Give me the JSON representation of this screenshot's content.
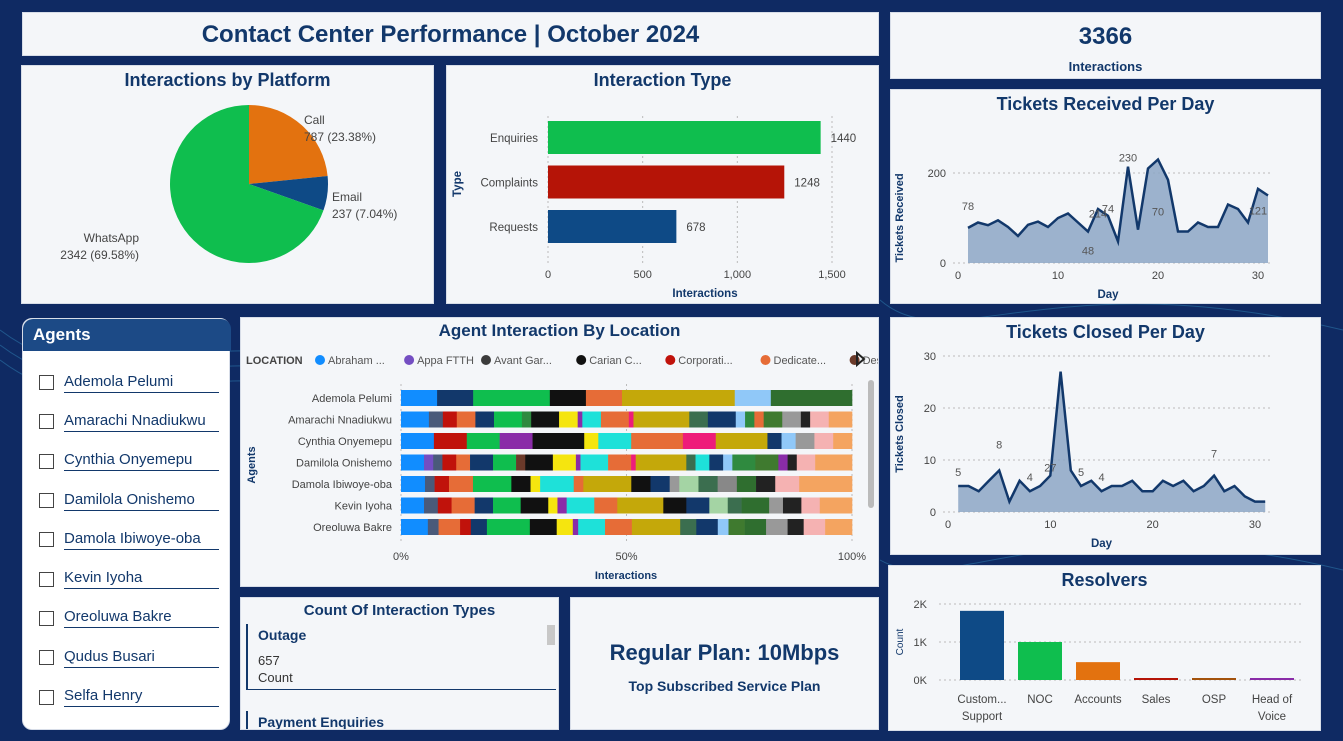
{
  "header": {
    "title": "Contact Center Performance | October 2024"
  },
  "kpi": {
    "value": "3366",
    "label": "Interactions"
  },
  "platform_chart": {
    "title": "Interactions by Platform",
    "slices": [
      {
        "name": "Call",
        "value": 787,
        "label": "787 (23.38%)",
        "color": "#e3720f"
      },
      {
        "name": "Email",
        "value": 237,
        "label": "237 (7.04%)",
        "color": "#0e4a86"
      },
      {
        "name": "WhatsApp",
        "value": 2342,
        "label": "2342 (69.58%)",
        "color": "#0fbe4e"
      }
    ]
  },
  "type_chart": {
    "title": "Interaction Type",
    "ylabel": "Type",
    "xlabel": "Interactions",
    "ticks": [
      "0",
      "500",
      "1,000",
      "1,500"
    ],
    "bars": [
      {
        "name": "Enquiries",
        "value": 1440,
        "label": "1440",
        "color": "#0fbe4e"
      },
      {
        "name": "Complaints",
        "value": 1248,
        "label": "1248",
        "color": "#b51407"
      },
      {
        "name": "Requests",
        "value": 678,
        "label": "678",
        "color": "#0e4a86"
      }
    ]
  },
  "received_chart": {
    "title": "Tickets Received Per Day",
    "ylabel": "Tickets Received",
    "xlabel": "Day",
    "yticks": [
      "0",
      "200"
    ],
    "xticks": [
      "0",
      "10",
      "20",
      "30"
    ],
    "labels": [
      "78",
      "214",
      "48",
      "74",
      "230",
      "70",
      "121"
    ]
  },
  "closed_chart": {
    "title": "Tickets Closed Per Day",
    "ylabel": "Tickets Closed",
    "xlabel": "Day",
    "yticks": [
      "0",
      "10",
      "20",
      "30"
    ],
    "xticks": [
      "0",
      "10",
      "20",
      "30"
    ],
    "labels": [
      "5",
      "8",
      "4",
      "27",
      "5",
      "4",
      "7"
    ]
  },
  "agents": {
    "title": "Agents",
    "items": [
      "Ademola Pelumi",
      "Amarachi Nnadiukwu",
      "Cynthia Onyemepu",
      "Damilola Onishemo",
      "Damola Ibiwoye-oba",
      "Kevin Iyoha",
      "Oreoluwa Bakre",
      "Qudus Busari",
      "Selfa Henry"
    ]
  },
  "location_chart": {
    "title": "Agent Interaction By Location",
    "legend_title": "LOCATION",
    "legend": [
      {
        "name": "Abraham ...",
        "color": "#118dff"
      },
      {
        "name": "Appa FTTH",
        "color": "#744ec2"
      },
      {
        "name": "Avant Gar...",
        "color": "#3b3b3b"
      },
      {
        "name": "Carian C...",
        "color": "#111111"
      },
      {
        "name": "Corporati...",
        "color": "#c0120b"
      },
      {
        "name": "Dedicate...",
        "color": "#e66c37"
      },
      {
        "name": "Destiny",
        "color": "#6b3a2a"
      }
    ],
    "ylabel": "Agents",
    "xlabel": "Interactions",
    "xticks": [
      "0%",
      "50%",
      "100%"
    ],
    "rows": [
      "Ademola Pelumi",
      "Amarachi Nnadiukwu",
      "Cynthia Onyemepu",
      "Damilola Onishemo",
      "Damola Ibiwoye-oba",
      "Kevin Iyoha",
      "Oreoluwa Bakre"
    ]
  },
  "count_types": {
    "title": "Count Of Interaction Types",
    "card1": {
      "name": "Outage",
      "value": "657",
      "label": "Count"
    },
    "card2": {
      "name": "Payment Enquiries"
    }
  },
  "plan": {
    "title": "Regular Plan: 10Mbps",
    "subtitle": "Top Subscribed Service Plan"
  },
  "resolvers_chart": {
    "title": "Resolvers",
    "ylabel": "Count",
    "yticks": [
      "0K",
      "1K",
      "2K"
    ],
    "bars": [
      {
        "name": "Custom...\nSupport",
        "value": 1820,
        "color": "#0e4a86"
      },
      {
        "name": "NOC",
        "value": 1000,
        "color": "#0fbe4e"
      },
      {
        "name": "Accounts",
        "value": 470,
        "color": "#e3720f"
      },
      {
        "name": "Sales",
        "value": 40,
        "color": "#b51407"
      },
      {
        "name": "OSP",
        "value": 20,
        "color": "#a3520c"
      },
      {
        "name": "Head of\nVoice",
        "value": 15,
        "color": "#8a2ca8"
      }
    ]
  },
  "chart_data": [
    {
      "type": "pie",
      "title": "Interactions by Platform",
      "categories": [
        "Call",
        "Email",
        "WhatsApp"
      ],
      "values": [
        787,
        237,
        2342
      ]
    },
    {
      "type": "bar",
      "title": "Interaction Type",
      "categories": [
        "Enquiries",
        "Complaints",
        "Requests"
      ],
      "values": [
        1440,
        1248,
        678
      ],
      "xlabel": "Interactions",
      "ylabel": "Type",
      "xlim": [
        0,
        1600
      ]
    },
    {
      "type": "area",
      "title": "Tickets Received Per Day",
      "xlabel": "Day",
      "ylabel": "Tickets Received",
      "x": [
        1,
        2,
        3,
        4,
        5,
        6,
        7,
        8,
        9,
        10,
        11,
        12,
        13,
        14,
        15,
        16,
        17,
        18,
        19,
        20,
        21,
        22,
        23,
        24,
        25,
        26,
        27,
        28,
        29,
        30,
        31
      ],
      "values": [
        78,
        90,
        84,
        95,
        80,
        60,
        85,
        92,
        80,
        100,
        110,
        90,
        70,
        120,
        105,
        48,
        214,
        74,
        210,
        230,
        185,
        70,
        70,
        90,
        80,
        80,
        130,
        120,
        90,
        165,
        150,
        121
      ],
      "xlim": [
        0,
        32
      ],
      "ylim": [
        0,
        250
      ]
    },
    {
      "type": "area",
      "title": "Tickets Closed Per Day",
      "xlabel": "Day",
      "ylabel": "Tickets Closed",
      "x": [
        1,
        2,
        3,
        4,
        5,
        6,
        7,
        8,
        9,
        10,
        11,
        12,
        13,
        14,
        15,
        16,
        17,
        18,
        19,
        20,
        21,
        22,
        23,
        24,
        25,
        26,
        27,
        28,
        29,
        30,
        31
      ],
      "values": [
        5,
        5,
        4,
        6,
        8,
        2,
        6,
        4,
        5,
        7,
        27,
        8,
        5,
        6,
        4,
        5,
        5,
        6,
        4,
        4,
        6,
        5,
        6,
        4,
        5,
        7,
        4,
        5,
        3,
        2,
        2
      ],
      "xlim": [
        0,
        32
      ],
      "ylim": [
        0,
        32
      ]
    },
    {
      "type": "bar",
      "title": "Agent Interaction By Location",
      "xlabel": "Interactions",
      "ylabel": "Agents",
      "categories": [
        "Ademola Pelumi",
        "Amarachi Nnadiukwu",
        "Cynthia Onyemepu",
        "Damilola Onishemo",
        "Damola Ibiwoye-oba",
        "Kevin Iyoha",
        "Oreoluwa Bakre"
      ],
      "stacked_percent": true,
      "segments": [
        [
          {
            "c": "#118dff",
            "w": 8
          },
          {
            "c": "#12386b",
            "w": 8
          },
          {
            "c": "#0fbe4e",
            "w": 17
          },
          {
            "c": "#111111",
            "w": 8
          },
          {
            "c": "#e66c37",
            "w": 8
          },
          {
            "c": "#c4a80a",
            "w": 25
          },
          {
            "c": "#90c8f8",
            "w": 8
          },
          {
            "c": "#2f6e2f",
            "w": 18
          }
        ],
        [
          {
            "c": "#118dff",
            "w": 6
          },
          {
            "c": "#4a5a7a",
            "w": 3
          },
          {
            "c": "#c0120b",
            "w": 3
          },
          {
            "c": "#e66c37",
            "w": 4
          },
          {
            "c": "#12386b",
            "w": 4
          },
          {
            "c": "#0fbe4e",
            "w": 6
          },
          {
            "c": "#2f8a3f",
            "w": 2
          },
          {
            "c": "#111111",
            "w": 6
          },
          {
            "c": "#f5e50f",
            "w": 4
          },
          {
            "c": "#8a2ca8",
            "w": 1
          },
          {
            "c": "#1ee1d9",
            "w": 4
          },
          {
            "c": "#e66c37",
            "w": 6
          },
          {
            "c": "#ee1c7a",
            "w": 1
          },
          {
            "c": "#c4a80a",
            "w": 12
          },
          {
            "c": "#3b6e4f",
            "w": 4
          },
          {
            "c": "#12386b",
            "w": 6
          },
          {
            "c": "#90c8f8",
            "w": 2
          },
          {
            "c": "#2f8a3f",
            "w": 2
          },
          {
            "c": "#e66c37",
            "w": 2
          },
          {
            "c": "#3f7a2f",
            "w": 4
          },
          {
            "c": "#999999",
            "w": 4
          },
          {
            "c": "#222222",
            "w": 2
          },
          {
            "c": "#f5b2b2",
            "w": 4
          },
          {
            "c": "#f4a460",
            "w": 5
          }
        ],
        [
          {
            "c": "#118dff",
            "w": 7
          },
          {
            "c": "#c0120b",
            "w": 7
          },
          {
            "c": "#0fbe4e",
            "w": 7
          },
          {
            "c": "#8a2ca8",
            "w": 7
          },
          {
            "c": "#111111",
            "w": 11
          },
          {
            "c": "#f5e50f",
            "w": 3
          },
          {
            "c": "#1ee1d9",
            "w": 7
          },
          {
            "c": "#e66c37",
            "w": 11
          },
          {
            "c": "#ee1c7a",
            "w": 7
          },
          {
            "c": "#c4a80a",
            "w": 11
          },
          {
            "c": "#12386b",
            "w": 3
          },
          {
            "c": "#90c8f8",
            "w": 3
          },
          {
            "c": "#999999",
            "w": 4
          },
          {
            "c": "#f5b2b2",
            "w": 4
          },
          {
            "c": "#f4a460",
            "w": 4
          }
        ],
        [
          {
            "c": "#118dff",
            "w": 5
          },
          {
            "c": "#744ec2",
            "w": 2
          },
          {
            "c": "#4a5a7a",
            "w": 2
          },
          {
            "c": "#c0120b",
            "w": 3
          },
          {
            "c": "#e66c37",
            "w": 3
          },
          {
            "c": "#12386b",
            "w": 5
          },
          {
            "c": "#0fbe4e",
            "w": 5
          },
          {
            "c": "#6b3a2a",
            "w": 2
          },
          {
            "c": "#111111",
            "w": 6
          },
          {
            "c": "#f5e50f",
            "w": 5
          },
          {
            "c": "#8a2ca8",
            "w": 1
          },
          {
            "c": "#1ee1d9",
            "w": 6
          },
          {
            "c": "#e66c37",
            "w": 5
          },
          {
            "c": "#ee1c7a",
            "w": 1
          },
          {
            "c": "#c4a80a",
            "w": 11
          },
          {
            "c": "#3b6e4f",
            "w": 2
          },
          {
            "c": "#1ee1d9",
            "w": 3
          },
          {
            "c": "#12386b",
            "w": 3
          },
          {
            "c": "#90c8f8",
            "w": 2
          },
          {
            "c": "#2f8a3f",
            "w": 5
          },
          {
            "c": "#3f7a2f",
            "w": 5
          },
          {
            "c": "#8a2ca8",
            "w": 2
          },
          {
            "c": "#222222",
            "w": 2
          },
          {
            "c": "#f5b2b2",
            "w": 4
          },
          {
            "c": "#f4a460",
            "w": 8
          }
        ],
        [
          {
            "c": "#118dff",
            "w": 5
          },
          {
            "c": "#4a5a7a",
            "w": 2
          },
          {
            "c": "#c0120b",
            "w": 3
          },
          {
            "c": "#e66c37",
            "w": 5
          },
          {
            "c": "#0fbe4e",
            "w": 8
          },
          {
            "c": "#111111",
            "w": 4
          },
          {
            "c": "#f5e50f",
            "w": 2
          },
          {
            "c": "#1ee1d9",
            "w": 7
          },
          {
            "c": "#e66c37",
            "w": 2
          },
          {
            "c": "#c4a80a",
            "w": 10
          },
          {
            "c": "#111111",
            "w": 4
          },
          {
            "c": "#12386b",
            "w": 4
          },
          {
            "c": "#999999",
            "w": 2
          },
          {
            "c": "#a4d4a4",
            "w": 4
          },
          {
            "c": "#3b6e4f",
            "w": 4
          },
          {
            "c": "#888888",
            "w": 4
          },
          {
            "c": "#2f6e2f",
            "w": 4
          },
          {
            "c": "#222222",
            "w": 4
          },
          {
            "c": "#f5b2b2",
            "w": 5
          },
          {
            "c": "#f4a460",
            "w": 11
          }
        ],
        [
          {
            "c": "#118dff",
            "w": 5
          },
          {
            "c": "#4a5a7a",
            "w": 3
          },
          {
            "c": "#c0120b",
            "w": 3
          },
          {
            "c": "#e66c37",
            "w": 5
          },
          {
            "c": "#12386b",
            "w": 4
          },
          {
            "c": "#0fbe4e",
            "w": 6
          },
          {
            "c": "#111111",
            "w": 6
          },
          {
            "c": "#f5e50f",
            "w": 2
          },
          {
            "c": "#8a2ca8",
            "w": 2
          },
          {
            "c": "#1ee1d9",
            "w": 6
          },
          {
            "c": "#e66c37",
            "w": 5
          },
          {
            "c": "#c4a80a",
            "w": 10
          },
          {
            "c": "#111111",
            "w": 5
          },
          {
            "c": "#12386b",
            "w": 5
          },
          {
            "c": "#a4d4a4",
            "w": 4
          },
          {
            "c": "#3b6e4f",
            "w": 3
          },
          {
            "c": "#2f6e2f",
            "w": 6
          },
          {
            "c": "#999999",
            "w": 3
          },
          {
            "c": "#222222",
            "w": 4
          },
          {
            "c": "#f5b2b2",
            "w": 4
          },
          {
            "c": "#f4a460",
            "w": 7
          }
        ],
        [
          {
            "c": "#118dff",
            "w": 5
          },
          {
            "c": "#4a5a7a",
            "w": 2
          },
          {
            "c": "#e66c37",
            "w": 4
          },
          {
            "c": "#c0120b",
            "w": 2
          },
          {
            "c": "#12386b",
            "w": 3
          },
          {
            "c": "#0fbe4e",
            "w": 8
          },
          {
            "c": "#111111",
            "w": 5
          },
          {
            "c": "#f5e50f",
            "w": 3
          },
          {
            "c": "#8a2ca8",
            "w": 1
          },
          {
            "c": "#1ee1d9",
            "w": 5
          },
          {
            "c": "#e66c37",
            "w": 5
          },
          {
            "c": "#c4a80a",
            "w": 9
          },
          {
            "c": "#3b6e4f",
            "w": 3
          },
          {
            "c": "#12386b",
            "w": 4
          },
          {
            "c": "#90c8f8",
            "w": 2
          },
          {
            "c": "#3f7a2f",
            "w": 3
          },
          {
            "c": "#2f6e2f",
            "w": 4
          },
          {
            "c": "#999999",
            "w": 4
          },
          {
            "c": "#222222",
            "w": 3
          },
          {
            "c": "#f5b2b2",
            "w": 4
          },
          {
            "c": "#f4a460",
            "w": 5
          }
        ]
      ]
    },
    {
      "type": "bar",
      "title": "Resolvers",
      "ylabel": "Count",
      "categories": [
        "Custom... Support",
        "NOC",
        "Accounts",
        "Sales",
        "OSP",
        "Head of Voice"
      ],
      "values": [
        1820,
        1000,
        470,
        40,
        20,
        15
      ],
      "ylim": [
        0,
        2200
      ]
    }
  ]
}
